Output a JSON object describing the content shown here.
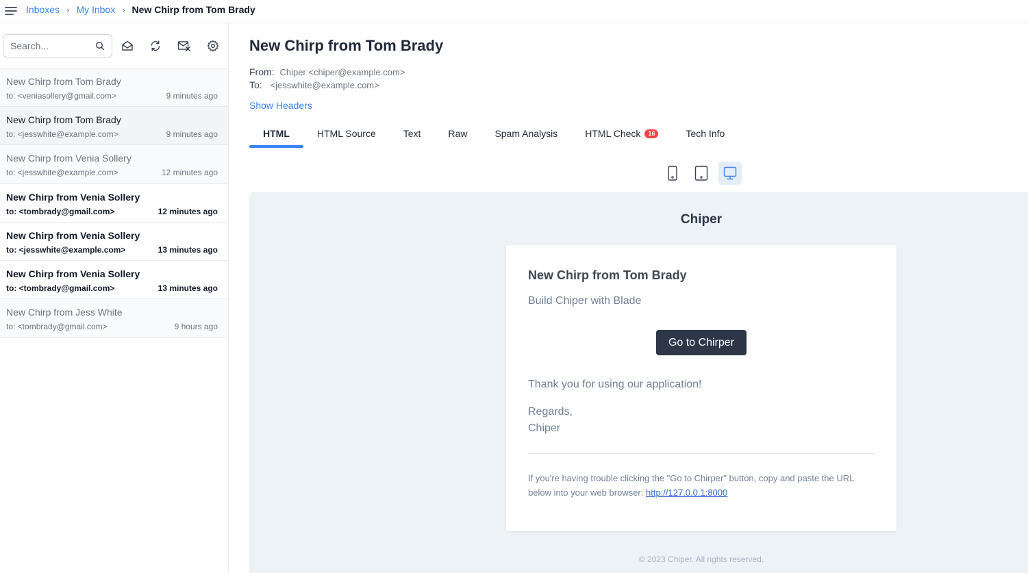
{
  "breadcrumb": {
    "inboxes": "Inboxes",
    "my_inbox": "My Inbox",
    "current": "New Chirp from Tom Brady"
  },
  "sidebar": {
    "search_placeholder": "Search...",
    "messages": [
      {
        "subject": "New Chirp from Tom Brady",
        "to": "to: <veniasollery@gmail.com>",
        "time": "9 minutes ago",
        "state": "read"
      },
      {
        "subject": "New Chirp from Tom Brady",
        "to": "to: <jesswhite@example.com>",
        "time": "9 minutes ago",
        "state": "active"
      },
      {
        "subject": "New Chirp from Venia Sollery",
        "to": "to: <jesswhite@example.com>",
        "time": "12 minutes ago",
        "state": "read"
      },
      {
        "subject": "New Chirp from Venia Sollery",
        "to": "to: <tombrady@gmail.com>",
        "time": "12 minutes ago",
        "state": "unread"
      },
      {
        "subject": "New Chirp from Venia Sollery",
        "to": "to: <jesswhite@example.com>",
        "time": "13 minutes ago",
        "state": "unread"
      },
      {
        "subject": "New Chirp from Venia Sollery",
        "to": "to: <tombrady@gmail.com>",
        "time": "13 minutes ago",
        "state": "unread"
      },
      {
        "subject": "New Chirp from Jess White",
        "to": "to: <tombrady@gmail.com>",
        "time": "9 hours ago",
        "state": "read"
      }
    ]
  },
  "message": {
    "subject": "New Chirp from Tom Brady",
    "from_label": "From:",
    "from_value": "Chiper <chiper@example.com>",
    "to_label": "To:",
    "to_value": "<jesswhite@example.com>",
    "show_headers": "Show Headers"
  },
  "tabs": [
    {
      "label": "HTML",
      "active": true
    },
    {
      "label": "HTML Source"
    },
    {
      "label": "Text"
    },
    {
      "label": "Raw"
    },
    {
      "label": "Spam Analysis"
    },
    {
      "label": "HTML Check",
      "badge": "16"
    },
    {
      "label": "Tech Info"
    }
  ],
  "preview": {
    "brand": "Chiper",
    "title": "New Chirp from Tom Brady",
    "body": "Build Chiper with Blade",
    "button": "Go to Chirper",
    "thanks": "Thank you for using our application!",
    "regards": "Regards,",
    "signature": "Chiper",
    "trouble_text": "If you're having trouble clicking the \"Go to Chirper\" button, copy and paste the URL below into your web browser:",
    "url": "http://127.0.0.1:8000",
    "copyright": "© 2023 Chiper. All rights reserved."
  },
  "colors": {
    "accent": "#3b82f6",
    "badge": "#ef4444",
    "button_dark": "#2d3748",
    "preview_bg": "#edf2f7"
  }
}
